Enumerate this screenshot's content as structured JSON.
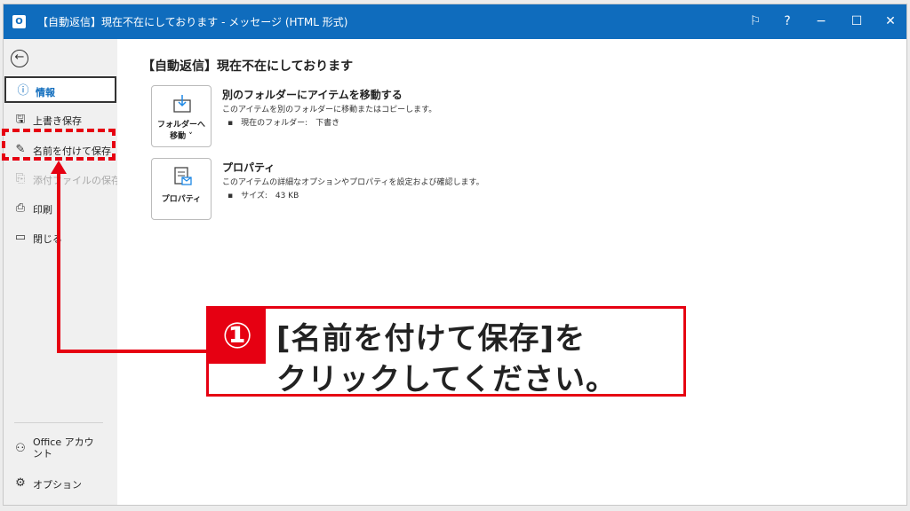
{
  "window": {
    "app_icon": "outlook-icon",
    "title": "【自動返信】現在不在にしております  -  メッセージ (HTML 形式)",
    "controls": {
      "feedback": "⚐",
      "help": "?",
      "minimize": "−",
      "maximize": "☐",
      "close": "✕"
    }
  },
  "sidebar": {
    "back_icon": "←",
    "items": [
      {
        "label": "情報",
        "icon": "info-icon",
        "glyph": "ⓘ"
      },
      {
        "label": "上書き保存",
        "icon": "save-icon",
        "glyph": "🖫"
      },
      {
        "label": "名前を付けて保存",
        "icon": "save-as-icon",
        "glyph": "✎"
      },
      {
        "label": "添付ファイルの保存",
        "icon": "save-attachment-icon",
        "glyph": "⎘"
      },
      {
        "label": "印刷",
        "icon": "print-icon",
        "glyph": "⎙"
      },
      {
        "label": "閉じる",
        "icon": "close-folder-icon",
        "glyph": "▭"
      }
    ],
    "footer": [
      {
        "label": "Office アカウント",
        "icon": "person-icon",
        "glyph": "⚇"
      },
      {
        "label": "オプション",
        "icon": "options-icon",
        "glyph": "⚙"
      }
    ]
  },
  "main": {
    "title": "【自動返信】現在不在にしております",
    "move": {
      "tile_line1": "フォルダーへ",
      "tile_line2": "移動 ˅",
      "title": "別のフォルダーにアイテムを移動する",
      "desc": "このアイテムを別のフォルダーに移動またはコピーします。",
      "bullet": "▪　現在のフォルダー:　下書き"
    },
    "properties": {
      "tile_label": "プロパティ",
      "title": "プロパティ",
      "desc": "このアイテムの詳細なオプションやプロパティを設定および確認します。",
      "bullet": "▪　サイズ:　43 KB"
    }
  },
  "callout": {
    "number": "①",
    "line1": "[名前を付けて保存]を",
    "line2": "クリックしてください。"
  },
  "colors": {
    "accent": "#0f6cbd",
    "highlight": "#e60012"
  }
}
